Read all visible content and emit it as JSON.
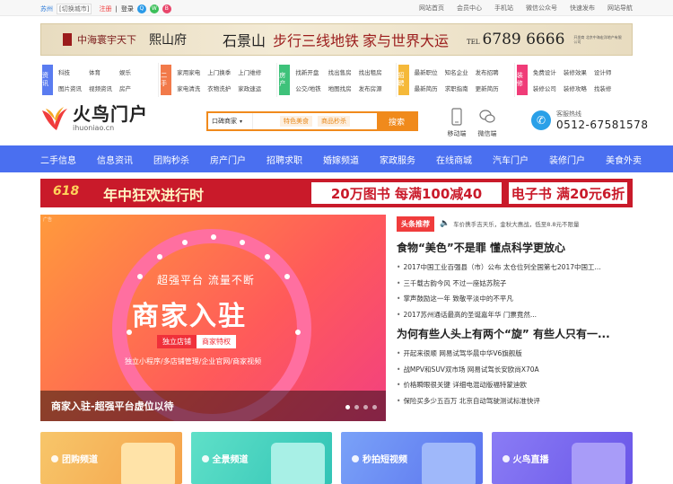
{
  "topbar": {
    "city": "苏州",
    "switch_city": "[切换城市]",
    "register": "注册",
    "login": "登录",
    "links": [
      "网站首页",
      "会员中心",
      "手机站",
      "微信公众号",
      "快速发布",
      "网站导航"
    ]
  },
  "ad": {
    "text1": "中海寰宇天下",
    "text2": "熙山府",
    "text3": "石景山",
    "text4": "步行三线地铁",
    "text5": "家与世界大运",
    "tel_label": "TEL",
    "tel": "6789 6666",
    "small_print": "开发商 北京中海宏洋地产有限公司"
  },
  "categories": [
    {
      "badge": "资讯",
      "color": "#5a7cf0",
      "links": [
        "科技",
        "体育",
        "娱乐",
        "图片资讯",
        "视频资讯",
        "房产"
      ]
    },
    {
      "badge": "二手",
      "color": "#f27a4a",
      "links": [
        "家用家电",
        "上门换季",
        "上门维修",
        "家电清洗",
        "衣物洗护",
        "家政速运"
      ]
    },
    {
      "badge": "房产",
      "color": "#3ec27a",
      "links": [
        "找新开盘",
        "找出售房",
        "找出租房",
        "公交/地铁",
        "地图找房",
        "发布房源"
      ]
    },
    {
      "badge": "招聘",
      "color": "#f5b93a",
      "links": [
        "最新职位",
        "知名企业",
        "发布招聘",
        "最新简历",
        "求职指南",
        "更新简历"
      ]
    },
    {
      "badge": "装修",
      "color": "#f03c78",
      "links": [
        "免费设计",
        "装修效果",
        "设计师",
        "装修公司",
        "装修攻略",
        "找装修"
      ]
    }
  ],
  "brand": {
    "name": "火鸟门户",
    "domain": "ihuoniao.cn"
  },
  "search": {
    "scope": "口碑商家",
    "tags": [
      "特色美食",
      "商品秒杀"
    ],
    "button": "搜索"
  },
  "header_icons": [
    {
      "label": "移动端"
    },
    {
      "label": "微信端"
    }
  ],
  "hotline": {
    "label": "客服热线",
    "number": "0512-67581578"
  },
  "nav": [
    "二手信息",
    "信息资讯",
    "团购秒杀",
    "房产门户",
    "招聘求职",
    "婚嫁频道",
    "家政服务",
    "在线商城",
    "汽车门户",
    "装修门户",
    "美食外卖"
  ],
  "promo": {
    "tag": "618",
    "headline": "年中狂欢进行时",
    "offer1": "20万图书 每满100减40",
    "offer2": "电子书 满20元6折"
  },
  "slider": {
    "corner": "广告",
    "line1": "超强平台  流量不断",
    "line2": "商家入驻",
    "btn_a": "独立店铺",
    "btn_b": "商家特权",
    "line3": "独立小程序/多店铺管理/企业官网/商家视频",
    "caption": "商家入驻-超强平台虚位以待",
    "pages": 4,
    "active_page": 1
  },
  "news": {
    "label": "头条推荐",
    "marquee": "车价携手吉天乐，金秋大惠战，低至8.8元不限量",
    "headline1": "食物“美色”不是罪 懂点科学更放心",
    "list1": [
      "2017中国工业百强县（市）公布 太仓位列全国第七2017中国工...",
      "三千载古韵今风 不过一座姑苏院子",
      "掌声鼓励这一年 致敬平淡中的不平凡",
      "2017苏州通话最高的圣诞嘉年华 门票竟然..."
    ],
    "headline2": "为何有些人头上有两个“旋” 有些人只有一...",
    "list2": [
      "开起来很顺 网易试驾华晨中华V6旗舰版",
      "战MPV和SUV双市场 网易试驾长安欧尚X70A",
      "价格瞬眼很关键 详细电混动版福特蒙迪欧",
      "保险买多少五百万 北京自动驾驶测试标准快评"
    ]
  },
  "cards": [
    {
      "label": "团购频道",
      "color": "#f5b55a"
    },
    {
      "label": "全景频道",
      "color": "#4fd6c0"
    },
    {
      "label": "秒拍短视频",
      "color": "#6a8cf5"
    },
    {
      "label": "火鸟直播",
      "color": "#7a6cf0"
    }
  ]
}
